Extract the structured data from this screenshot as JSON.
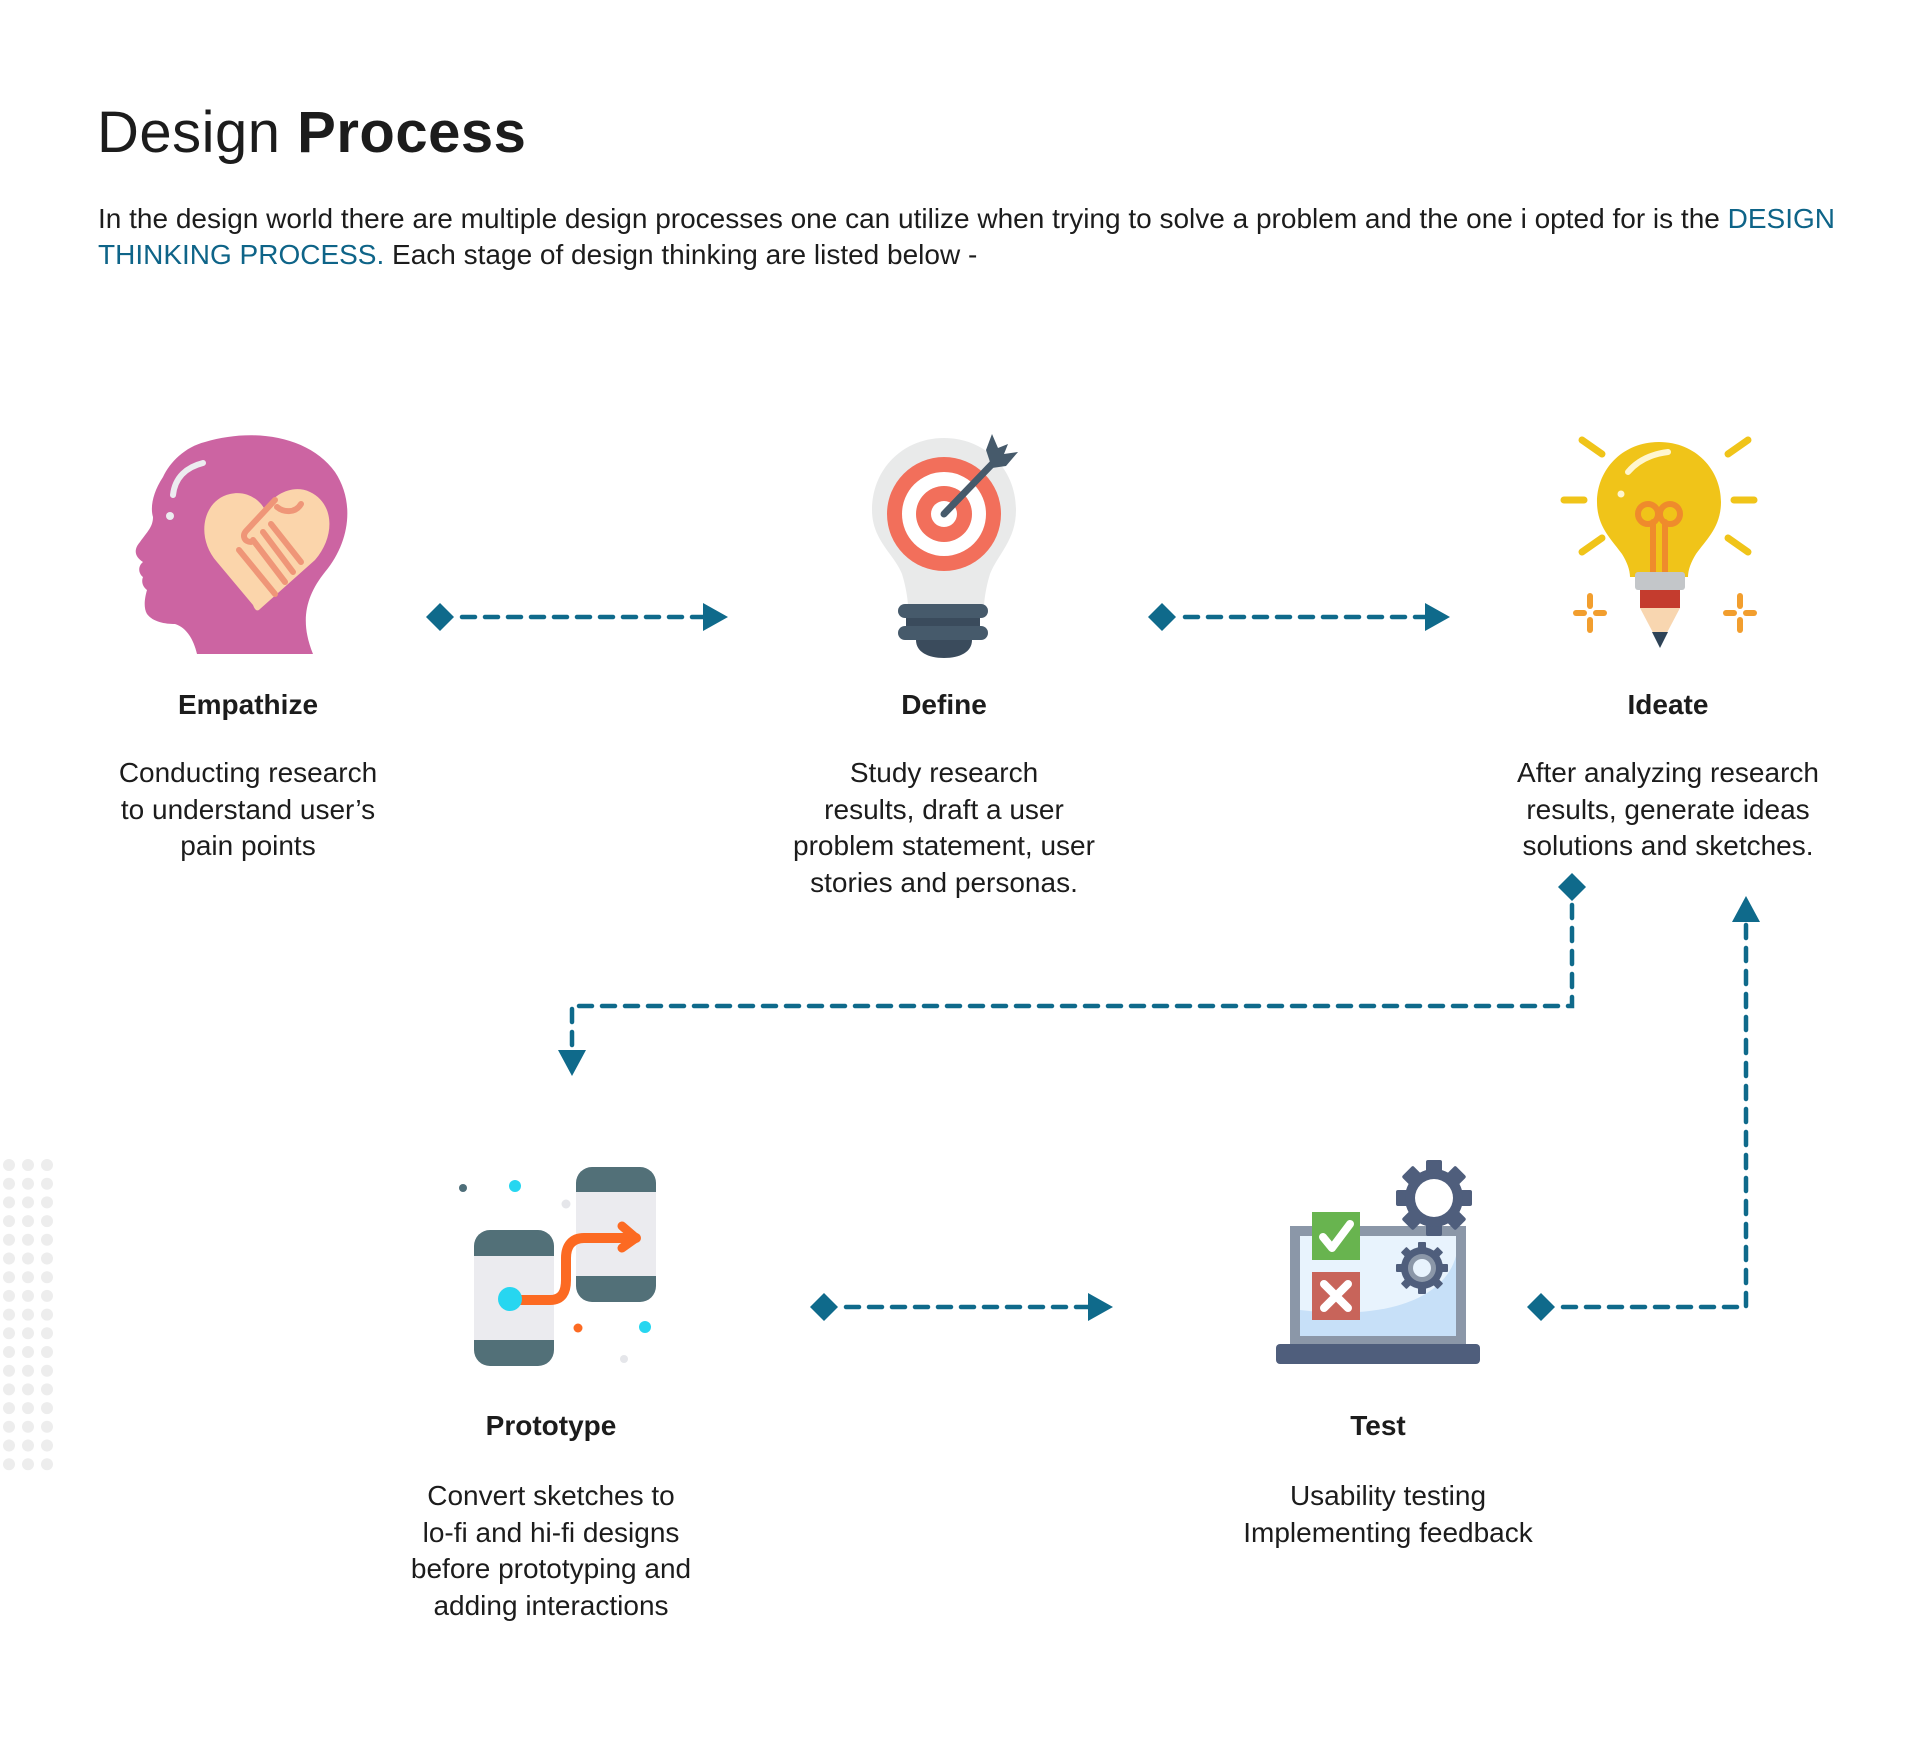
{
  "header": {
    "title_light": "Design",
    "title_bold": "Process"
  },
  "intro": {
    "text_before": "In the design world there are multiple design processes one can utilize when trying to solve a problem and the one i opted for is the ",
    "highlight": "DESIGN THINKING PROCESS.",
    "text_after": " Each stage of design thinking are listed below -"
  },
  "colors": {
    "connector": "#0f6a8b",
    "highlight_text": "#0e6488"
  },
  "stages": [
    {
      "label": "Empathize",
      "icon": "head-heart-handshake-icon",
      "description": "Conducting research\nto understand user’s\npain points"
    },
    {
      "label": "Define",
      "icon": "lightbulb-target-icon",
      "description": "Study research\nresults, draft a user\nproblem statement, user\nstories and personas."
    },
    {
      "label": "Ideate",
      "icon": "lightbulb-pencil-icon",
      "description": "After analyzing research\nresults, generate ideas\nsolutions and sketches."
    },
    {
      "label": "Prototype",
      "icon": "phones-flow-icon",
      "description": "Convert sketches to\nlo-fi and hi-fi designs\nbefore prototyping and\nadding interactions"
    },
    {
      "label": "Test",
      "icon": "laptop-checklist-gear-icon",
      "description": "Usability testing\nImplementing feedback"
    }
  ],
  "connectors": [
    {
      "from": "Empathize",
      "to": "Define"
    },
    {
      "from": "Define",
      "to": "Ideate"
    },
    {
      "from": "Ideate",
      "to": "Prototype"
    },
    {
      "from": "Prototype",
      "to": "Test"
    },
    {
      "from": "Test",
      "to": "Ideate"
    }
  ]
}
